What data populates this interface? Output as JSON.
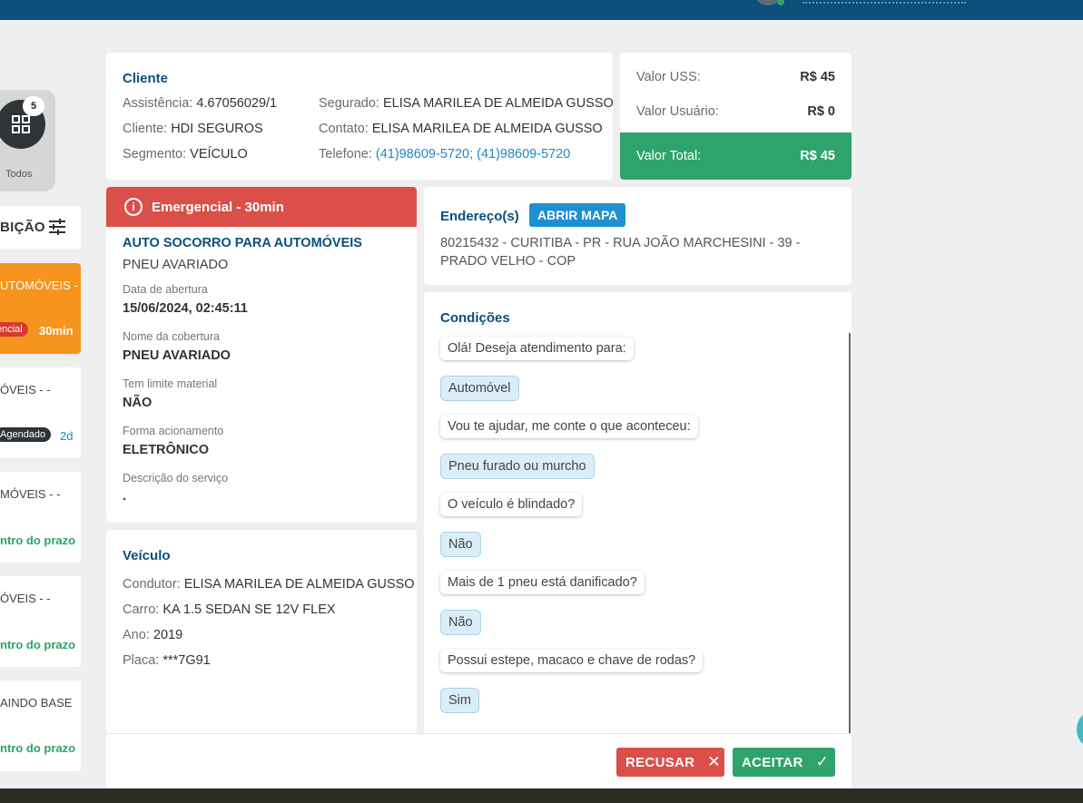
{
  "sidebar": {
    "todos": {
      "label": "Todos",
      "count": "5"
    },
    "distribuicao_label": "BIÇÃO",
    "items": [
      {
        "title": "UTOMÓVEIS -",
        "chip": "encial",
        "extra": "30min"
      },
      {
        "title": "ÓVEIS - -",
        "chip": "Agendado",
        "extra": "2d"
      },
      {
        "title": "MÓVEIS - -",
        "extra": "ntro do prazo"
      },
      {
        "title": "ÓVEIS - -",
        "extra": "ntro do prazo"
      },
      {
        "title": "AINDO BASE",
        "extra": "ntro do prazo"
      }
    ]
  },
  "cliente": {
    "title": "Cliente",
    "assistencia_label": "Assistência:",
    "assistencia": "4.67056029/1",
    "cliente_label": "Cliente:",
    "cliente": "HDI SEGUROS",
    "segmento_label": "Segmento:",
    "segmento": "VEÍCULO",
    "segurado_label": "Segurado:",
    "segurado": "ELISA MARILEA DE ALMEIDA GUSSO",
    "contato_label": "Contato:",
    "contato": "ELISA MARILEA DE ALMEIDA GUSSO",
    "telefone_label": "Telefone:",
    "telefone": "(41)98609-5720; (41)98609-5720"
  },
  "valores": {
    "uss_label": "Valor USS:",
    "uss": "R$ 45",
    "usuario_label": "Valor Usuário:",
    "usuario": "R$ 0",
    "total_label": "Valor Total:",
    "total": "R$ 45"
  },
  "servico": {
    "urgencia": "Emergencial - 30min",
    "titulo": "AUTO SOCORRO PARA AUTOMÓVEIS",
    "subtitulo": "PNEU AVARIADO",
    "data_abertura_label": "Data de abertura",
    "data_abertura": "15/06/2024, 02:45:11",
    "cobertura_label": "Nome da cobertura",
    "cobertura": "PNEU AVARIADO",
    "limite_label": "Tem limite material",
    "limite": "NÃO",
    "acionamento_label": "Forma acionamento",
    "acionamento": "ELETRÔNICO",
    "descricao_label": "Descrição do serviço",
    "descricao": "."
  },
  "veiculo": {
    "title": "Veículo",
    "condutor_label": "Condutor:",
    "condutor": "ELISA MARILEA DE ALMEIDA GUSSO",
    "carro_label": "Carro:",
    "carro": "KA 1.5 SEDAN SE 12V FLEX",
    "ano_label": "Ano:",
    "ano": "2019",
    "placa_label": "Placa:",
    "placa": "***7G91"
  },
  "endereco": {
    "title": "Endereço(s)",
    "map_button": "ABRIR MAPA",
    "text": "80215432 - CURITIBA - PR - RUA JOÃO MARCHESINI - 39 - PRADO VELHO - COP"
  },
  "condicoes": {
    "title": "Condições",
    "messages": [
      "Olá! Deseja atendimento para:",
      "Automóvel",
      "Vou te ajudar, me conte o que aconteceu:",
      "Pneu furado ou murcho",
      "O veículo é blindado?",
      "Não",
      "Mais de 1 pneu está danificado?",
      "Não",
      "Possui estepe, macaco e chave de rodas?",
      "Sim"
    ]
  },
  "actions": {
    "recusar": "RECUSAR",
    "aceitar": "ACEITAR"
  }
}
